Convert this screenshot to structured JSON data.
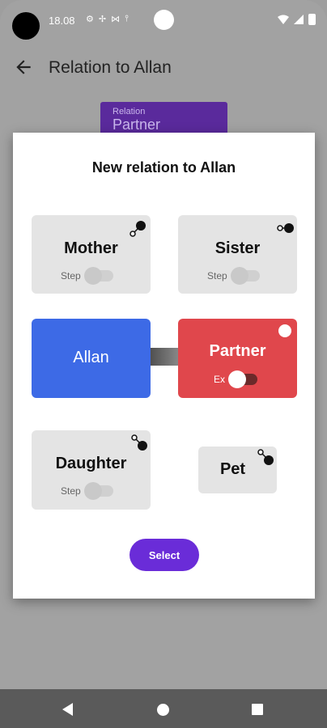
{
  "status": {
    "time": "18.08"
  },
  "appbar": {
    "title": "Relation to Allan"
  },
  "background_chip": {
    "caption": "Relation",
    "value": "Partner"
  },
  "dialog": {
    "title": "New relation to Allan",
    "cards": {
      "mother": {
        "label": "Mother",
        "toggle_label": "Step",
        "toggle_on": false
      },
      "sister": {
        "label": "Sister",
        "toggle_label": "Step",
        "toggle_on": false
      },
      "allan": {
        "label": "Allan",
        "color": "#3d6ae6"
      },
      "partner": {
        "label": "Partner",
        "toggle_label": "Ex",
        "toggle_on": true,
        "color": "#e0474c"
      },
      "daughter": {
        "label": "Daughter",
        "toggle_label": "Step",
        "toggle_on": false
      },
      "pet": {
        "label": "Pet"
      }
    },
    "select_label": "Select"
  },
  "colors": {
    "accent": "#6a2cd8",
    "self_card": "#3d6ae6",
    "selected_card": "#e0474c"
  }
}
